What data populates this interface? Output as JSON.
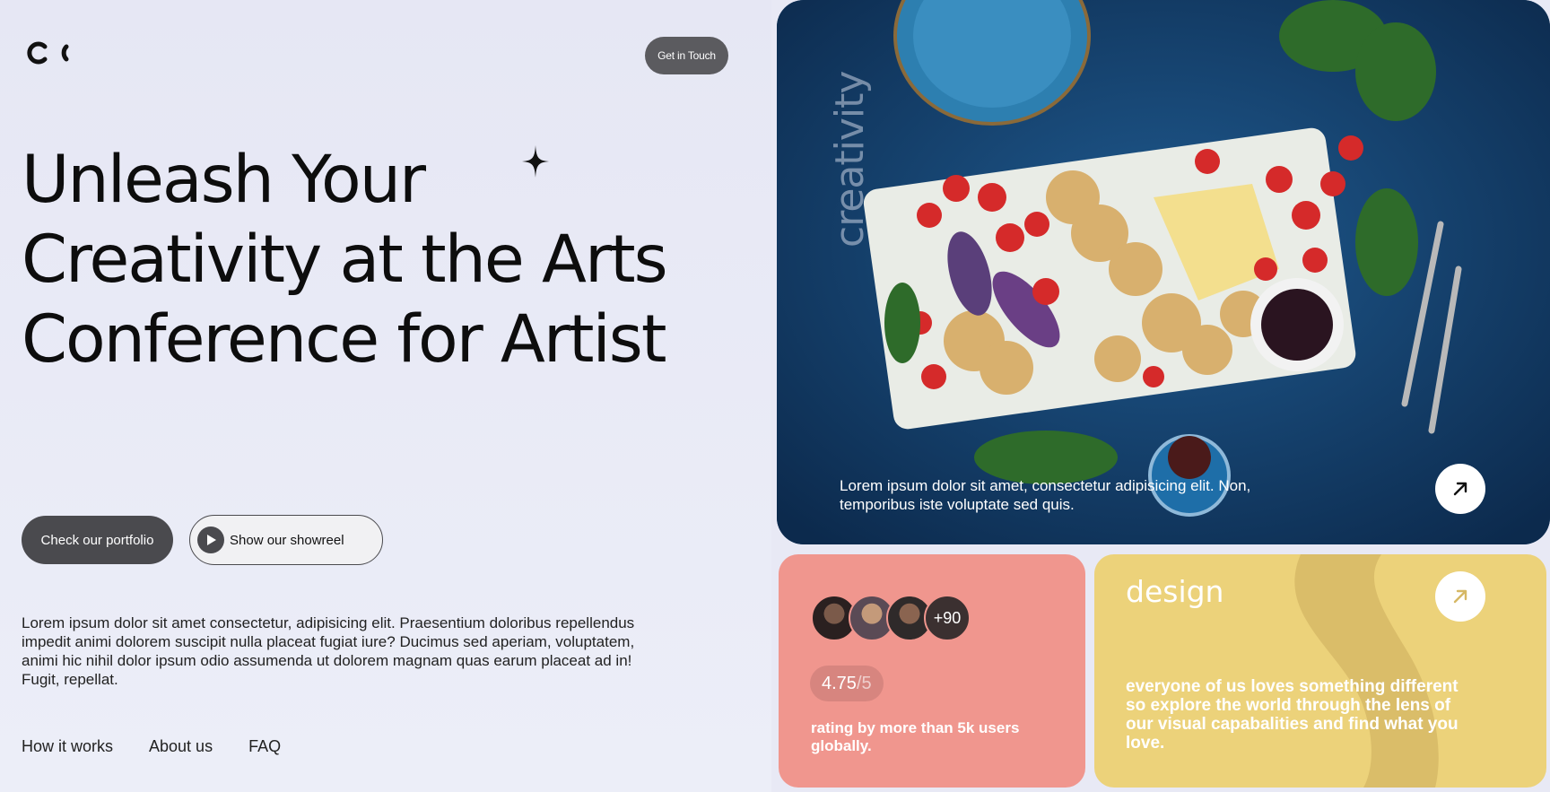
{
  "header": {
    "logo_icon": "cc-logo-icon",
    "cta_label": "Get in Touch"
  },
  "hero_left": {
    "headline": "Unleash Your Creativity at the Arts Conference for Artist",
    "sparkle_icon": "sparkle-icon",
    "primary_button": "Check our portfolio",
    "secondary_button": "Show our showreel",
    "play_icon": "play-icon",
    "description": "Lorem ipsum dolor sit amet consectetur, adipisicing elit. Praesentium doloribus repellendus impedit animi dolorem suscipit nulla placeat fugiat iure? Ducimus sed aperiam, voluptatem, animi hic nihil dolor ipsum odio assumenda ut dolorem magnam quas earum placeat ad in! Fugit, repellat."
  },
  "footer_nav": {
    "items": [
      "How it works",
      "About us",
      "FAQ"
    ]
  },
  "hero_image": {
    "vertical_word": "creativity",
    "caption": "Lorem ipsum dolor sit amet, consectetur adipisicing elit. Non, temporibus iste voluptate sed quis.",
    "arrow_icon": "arrow-up-right-icon"
  },
  "rating_card": {
    "more_count": "+90",
    "score": "4.75",
    "out_of": "/5",
    "text": "rating by more than 5k users globally.",
    "background": "#f0968e"
  },
  "design_card": {
    "title": "design",
    "text": "everyone of us loves something different so explore the world through the lens of our visual capabalities and find what you love.",
    "arrow_icon": "arrow-up-right-icon",
    "background": "#ecd27a"
  },
  "colors": {
    "page_bg": "#e8e9f5",
    "dark_button": "#4a4a4e",
    "hero_bg": "#123a66"
  }
}
